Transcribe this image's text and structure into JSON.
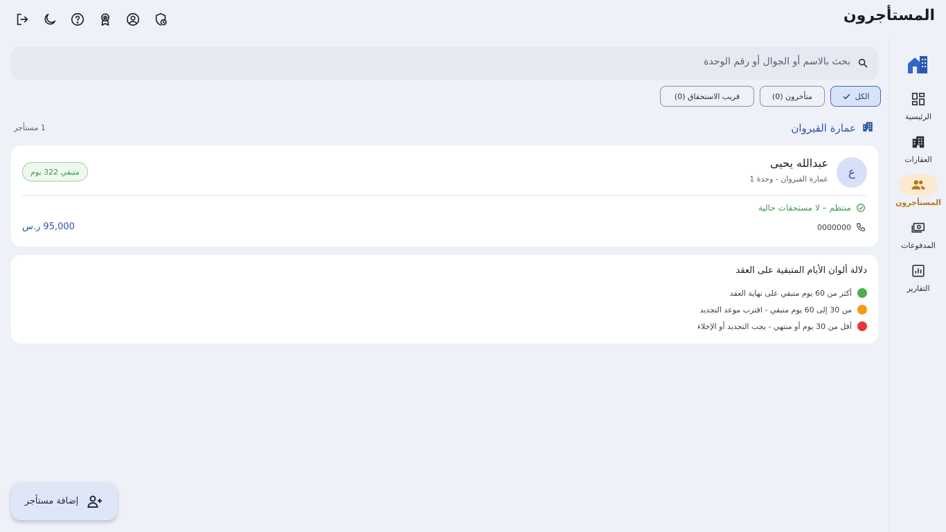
{
  "header": {
    "title": "المستأجرون",
    "icons": [
      "logout-icon",
      "dark-mode-icon",
      "help-icon",
      "award-icon",
      "account-icon",
      "clock-icon"
    ]
  },
  "sidebar": {
    "logo": "app-logo-home-building",
    "items": [
      {
        "label": "الرئيسية",
        "icon": "dashboard-icon",
        "active": false
      },
      {
        "label": "العقارات",
        "icon": "buildings-icon",
        "active": false
      },
      {
        "label": "المستأجرون",
        "icon": "people-icon",
        "active": true
      },
      {
        "label": "المدفوعات",
        "icon": "payments-icon",
        "active": false
      },
      {
        "label": "التقارير",
        "icon": "reports-icon",
        "active": false
      }
    ]
  },
  "search": {
    "placeholder": "بحث بالاسم أو الجوال أو رقم الوحدة"
  },
  "filters": [
    {
      "label": "الكل",
      "selected": true
    },
    {
      "label": "متأخرون (0)",
      "selected": false
    },
    {
      "label": "قريب الاستحقاق (0)",
      "selected": false
    }
  ],
  "group": {
    "title": "عمارة القيروان",
    "count": "1 مستأجر"
  },
  "tenant": {
    "initial": "ع",
    "name": "عبدالله يحيى",
    "unit": "عمارة القيروان - وحدة 1",
    "remaining": "متبقي 322 يوم",
    "status": "منتظم – لا مستحقات حالية",
    "phone": "0000000",
    "amount": "95,000 ر.س"
  },
  "legend": {
    "title": "دلالة ألوان الأيام المتبقية على العقد",
    "items": [
      {
        "text": "أكثر من 60 يوم متبقي على نهاية العقد",
        "color": "#4caf50"
      },
      {
        "text": "من 30 إلى 60 يوم متبقي - اقترب موعد التجديد",
        "color": "#f39c12"
      },
      {
        "text": "أقل من 30 يوم أو منتهي - يجب التجديد أو الإخلاء",
        "color": "#e53935"
      }
    ]
  },
  "fab": {
    "label": "إضافة مستأجر"
  },
  "colors": {
    "primary": "#2c55a8",
    "active_nav": "#b5751a",
    "success": "#3c9a4c",
    "background": "#eef1f8"
  }
}
